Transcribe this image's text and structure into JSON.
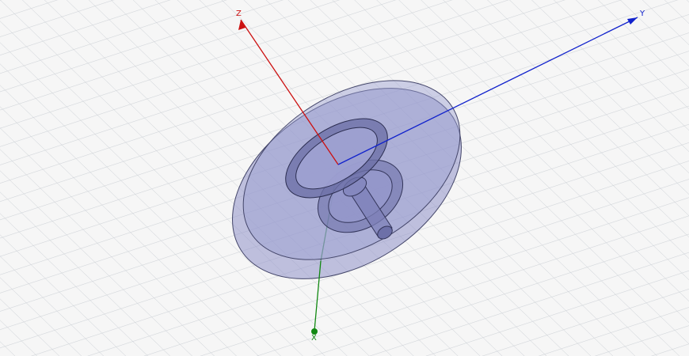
{
  "viewport": {
    "background": "#f6f6f6",
    "grid_color": "#cfd3d8"
  },
  "axes": {
    "z": {
      "label": "Z",
      "color": "#cc1111"
    },
    "y": {
      "label": "Y",
      "color": "#1122cc"
    },
    "x": {
      "label": "X",
      "color": "#118811"
    }
  },
  "model": {
    "body_fill": "#8f92c8",
    "body_stroke": "#44466a",
    "ring_fill": "#6d70a8"
  }
}
